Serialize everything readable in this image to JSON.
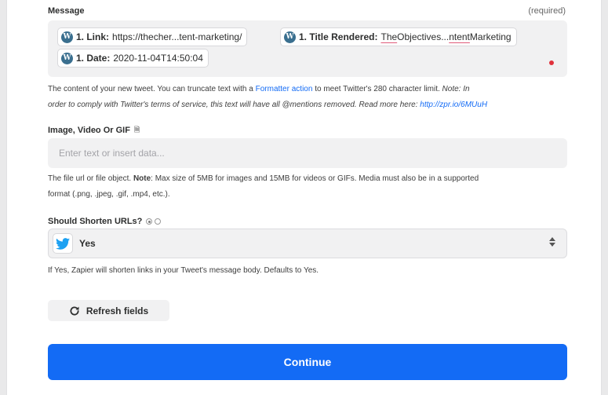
{
  "message": {
    "label": "Message",
    "required_text": "(required)",
    "pills": [
      {
        "key": "1. Link:",
        "value": "https://thecher...tent-marketing/"
      },
      {
        "key": "1. Title Rendered:",
        "value_part1": "The",
        "value_part2": " Objectives...",
        "value_part3": "ntent",
        "value_part4": " Marketing"
      },
      {
        "key": "1. Date:",
        "value": "2020-11-04T14:50:04"
      }
    ],
    "help_1": "The content of your new tweet. You can truncate text with a ",
    "help_link": "Formatter action",
    "help_2": " to meet Twitter's 280 character limit. ",
    "help_note_label": "Note:",
    "help_note_1": " In",
    "help_note_2": "order to comply with Twitter's terms of service, this text will have all @mentions removed. Read more here: ",
    "help_url": "http://zpr.io/6MUuH"
  },
  "image": {
    "label": "Image, Video Or GIF",
    "placeholder": "Enter text or insert data...",
    "help_1": "The file url or file object. ",
    "help_note": "Note",
    "help_2": ": Max size of 5MB for images and 15MB for videos or GIFs. Media must also be in a supported",
    "help_3": "format (.png, .jpeg, .gif, .mp4, etc.)."
  },
  "shorten": {
    "label": "Should Shorten URLs?",
    "value": "Yes",
    "help": "If Yes, Zapier will shorten links in your Tweet's message body. Defaults to Yes."
  },
  "buttons": {
    "refresh": "Refresh fields",
    "continue": "Continue"
  },
  "colors": {
    "accent": "#136bf5",
    "twitter": "#1da1f2"
  }
}
